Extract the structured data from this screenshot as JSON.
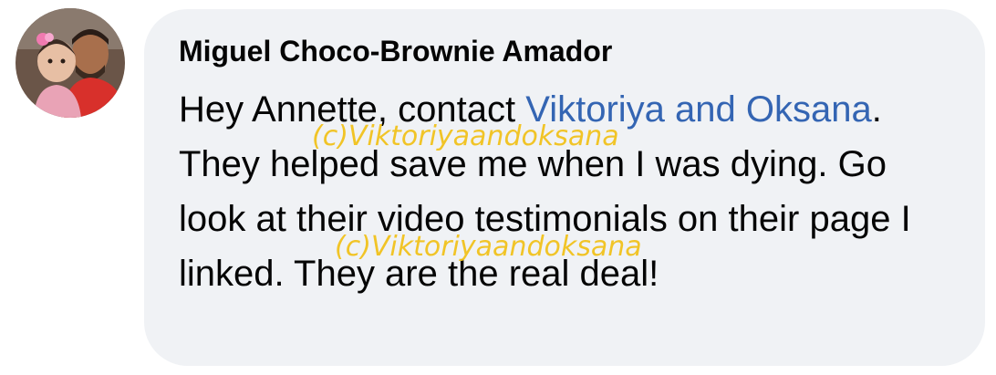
{
  "comment": {
    "author": "Miguel Choco-Brownie Amador",
    "message_before": "Hey Annette, contact ",
    "mention": "Viktoriya and Oksana",
    "message_after": ". They helped save me when I was dying. Go look at their video testimonials on their page I linked. They are the real deal!"
  },
  "watermark": {
    "text": "(c)Viktoriyaandoksana"
  },
  "colors": {
    "bubble": "#f0f2f5",
    "text": "#050505",
    "mention": "#3465b3",
    "watermark": "#f2c21c"
  }
}
